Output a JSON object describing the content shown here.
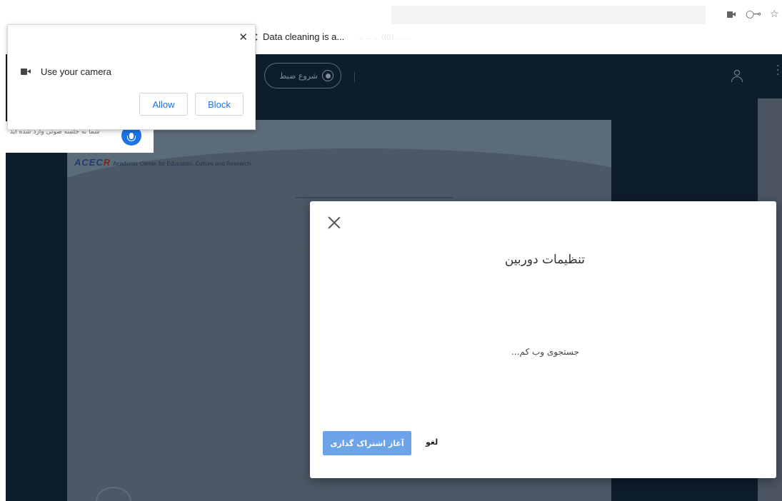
{
  "browser": {
    "tab_title": "Data cleaning is a...",
    "faded_text": "...  ...  ...  (((((  ...  ..."
  },
  "permission_popup": {
    "close_glyph": "✕",
    "request_text": "Use your camera",
    "allow_label": "Allow",
    "block_label": "Block"
  },
  "app_header": {
    "record_label": "شروع ضبط"
  },
  "notice": {
    "text": "شما به جلسه صوتی وارد شده اید"
  },
  "slide": {
    "logo_mark_a": "ACEC",
    "logo_mark_b": "R",
    "logo_sub": "Academic Center for Education, Culture and Research"
  },
  "webcam_modal": {
    "title": "تنظیمات دوربین",
    "status": "جستجوی وب کم...",
    "share_label": "آغاز اشتراک گذاری",
    "cancel_label": "لغو"
  },
  "colors": {
    "app_bg": "#0e1d2c",
    "primary_button": "#6da4e9",
    "chrome_accent": "#1a73e8"
  }
}
